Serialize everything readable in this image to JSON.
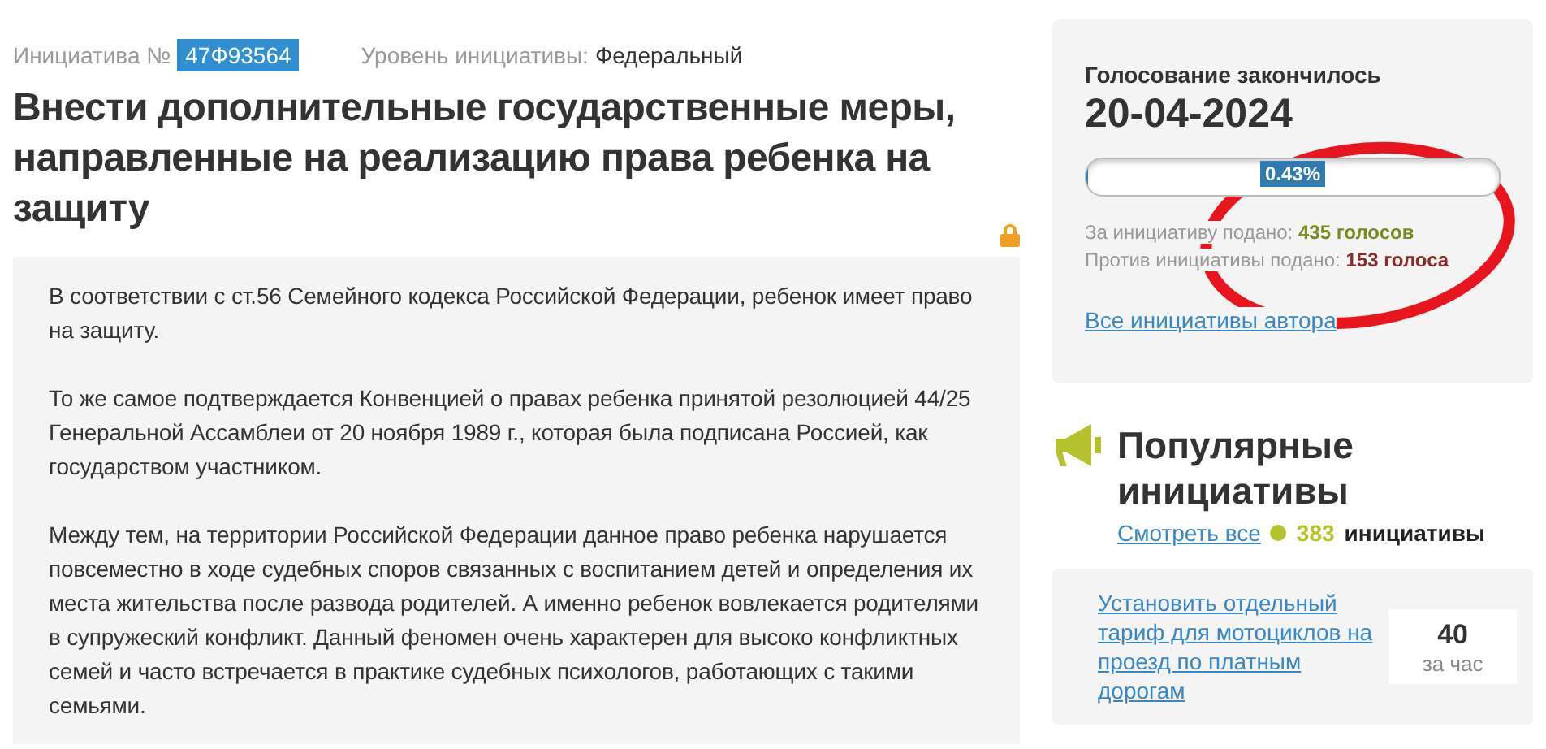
{
  "initiative": {
    "number_label": "Инициатива №",
    "number": "47Ф93564",
    "level_label": "Уровень инициативы:",
    "level_value": "Федеральный",
    "title": "Внести дополнительные государственные меры, направленные на реализацию права ребенка на защиту",
    "locked": true
  },
  "body": [
    "В соответствии с ст.56 Семейного кодекса Российской Федерации, ребенок имеет право на защиту.",
    "То же самое подтверждается Конвенцией о правах ребенка принятой резолюцией 44/25 Генеральной Ассамблеи от 20 ноября 1989 г., которая была подписана Россией, как государством участником.",
    "Между тем, на территории Российской Федерации данное право ребенка нарушается повсеместно в ходе судебных споров связанных с воспитанием детей и определения их места жительства после развода родителей. А именно ребенок вовлекается родителями в супружеский конфликт. Данный феномен очень характерен для высоко конфликтных семей и часто встречается в практике судебных психологов, работающих с такими семьями."
  ],
  "voting": {
    "status": "Голосование закончилось",
    "date": "20-04-2024",
    "progress": {
      "level": 0.0043,
      "label": "0.43%"
    },
    "votes": [
      {
        "label": "За инициативу подано:",
        "count": "435 голосов",
        "color": "#7a8a1c"
      },
      {
        "label": "Против инициативы подано:",
        "count": "153 голоса",
        "color": "#8b2a2a"
      }
    ],
    "author_link": "Все инициативы автора",
    "annotated": true
  },
  "popular": {
    "title": "Популярные инициативы",
    "view_all": "Смотреть все",
    "count": "383",
    "count_label": "инициативы",
    "color": "#b5c22e",
    "items": [
      {
        "title": "Установить отдельный тариф для мотоциклов на проезд по платным дорогам",
        "rate": "40",
        "rate_label": "за час"
      }
    ]
  }
}
